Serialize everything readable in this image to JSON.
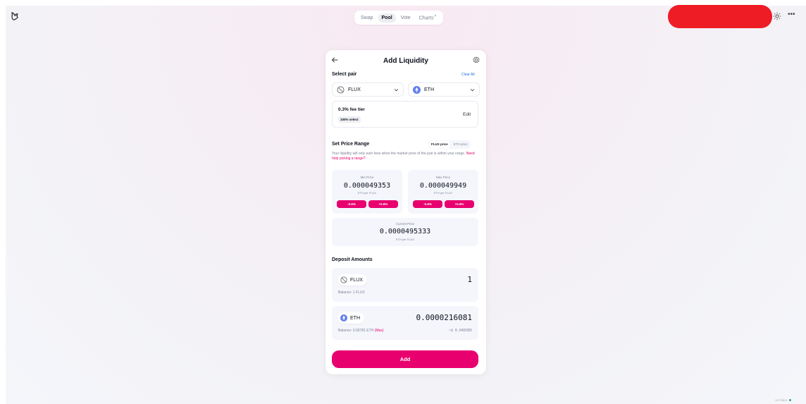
{
  "nav": {
    "items": [
      {
        "label": "Swap"
      },
      {
        "label": "Pool",
        "active": true
      },
      {
        "label": "Vote"
      },
      {
        "label": "Charts",
        "external_marker": "↗"
      }
    ]
  },
  "header": {
    "account_redacted_color": "#ee1c25",
    "theme_icon": "sun-icon",
    "more_icon": "more-icon",
    "more_label": "•••"
  },
  "card": {
    "title": "Add Liquidity",
    "select_pair_label": "Select pair",
    "clear_all_label": "Clear All",
    "token_a": {
      "symbol": "FLUX",
      "icon": "no-token-icon"
    },
    "token_b": {
      "symbol": "ETH",
      "icon": "eth-icon"
    },
    "fee": {
      "title": "0.3% fee tier",
      "badge": "100% select",
      "edit_label": "Edit"
    },
    "price_range": {
      "label": "Set Price Range",
      "toggle": [
        "FLUX price",
        "ETH price"
      ],
      "description": "Your liquidity will only earn fees when the market price of the pair is within your range.",
      "help_link": "Need help picking a range?",
      "min": {
        "label": "Min Price",
        "value": "0.000049353",
        "unit": "ETH per FLUX",
        "dec": "-0.6%",
        "inc": "+0.6%"
      },
      "max": {
        "label": "Max Price",
        "value": "0.000049949",
        "unit": "ETH per FLUX",
        "dec": "-0.6%",
        "inc": "+0.6%"
      },
      "current": {
        "label": "Current Price",
        "value": "0.0000495333",
        "unit": "ETH per FLUX"
      }
    },
    "deposit": {
      "label": "Deposit Amounts",
      "token_a": {
        "symbol": "FLUX",
        "amount": "1",
        "balance": "Balance: 1 FLUX"
      },
      "token_b": {
        "symbol": "ETH",
        "amount": "0.0000216081",
        "balance": "Balance: 0.00781 ETH",
        "max_label": "(Max)",
        "usd": "~$ 0.048385"
      }
    },
    "add_label": "Add"
  },
  "footer": {
    "block_number": "12778591"
  },
  "colors": {
    "accent": "#e8006f",
    "link": "#1f6fde"
  }
}
